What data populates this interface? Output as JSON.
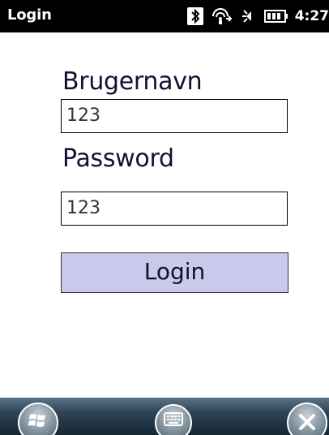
{
  "status_bar": {
    "title": "Login",
    "time": "4:27",
    "icons": [
      "bluetooth-icon",
      "network-icon",
      "volume-icon",
      "battery-icon"
    ]
  },
  "form": {
    "username_label": "Brugernavn",
    "username_value": "123",
    "password_label": "Password",
    "password_value": "123",
    "login_button_label": "Login"
  },
  "bottom_bar": {
    "icons": [
      "windows-start-icon",
      "keyboard-icon",
      "close-icon"
    ]
  },
  "colors": {
    "status_bar_bg": "#000000",
    "button_bg": "#c9c9ee",
    "label_text": "#111133"
  }
}
